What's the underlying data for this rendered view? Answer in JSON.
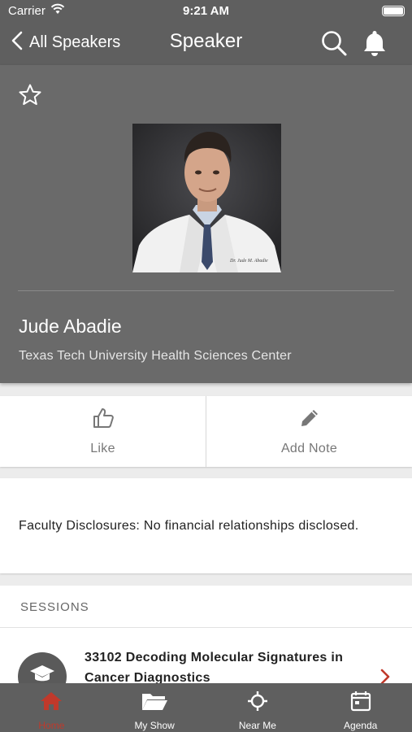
{
  "status_bar": {
    "carrier": "Carrier",
    "time": "9:21 AM"
  },
  "nav": {
    "back_label": "All Speakers",
    "title": "Speaker"
  },
  "speaker": {
    "name": "Jude Abadie",
    "organization": "Texas Tech University Health Sciences Center",
    "photo_alt": "Speaker photo"
  },
  "actions": {
    "like_label": "Like",
    "add_note_label": "Add Note"
  },
  "disclosure": {
    "text": "Faculty Disclosures: No financial relationships disclosed."
  },
  "sessions": {
    "header": "SESSIONS",
    "items": [
      {
        "title": "33102 Decoding Molecular Signatures in Cancer Diagnostics"
      }
    ]
  },
  "tabbar": {
    "items": [
      {
        "label": "Home",
        "icon": "home-icon"
      },
      {
        "label": "My Show",
        "icon": "folder-icon"
      },
      {
        "label": "Near Me",
        "icon": "location-crosshair-icon"
      },
      {
        "label": "Agenda",
        "icon": "calendar-icon"
      }
    ]
  },
  "colors": {
    "bar": "#5f5f5f",
    "hero": "#6a6a6a",
    "accent": "#c0392b"
  }
}
